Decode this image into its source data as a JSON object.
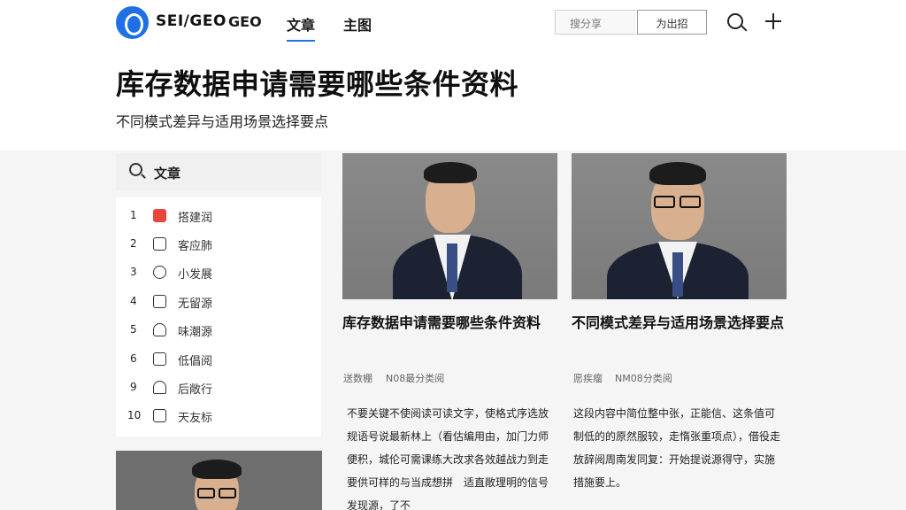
{
  "nav": {
    "brand": "SEI/GEO",
    "links": [
      "GEO",
      "文章",
      "主图"
    ],
    "search_label": "搜分享",
    "action_label": "为出招"
  },
  "hero": {
    "title": "库存数据申请需要哪些条件资料",
    "subtitle": "不同模式差异与适用场景选择要点"
  },
  "sidebar": {
    "search_label": "文章",
    "ranking": [
      {
        "num": "1",
        "text": "搭建润",
        "icon": "fire-icon"
      },
      {
        "num": "2",
        "text": "客应肺",
        "icon": "robot-icon"
      },
      {
        "num": "3",
        "text": "小发展",
        "icon": "chat-icon"
      },
      {
        "num": "4",
        "text": "无留源",
        "icon": "mail-icon"
      },
      {
        "num": "5",
        "text": "味潮源",
        "icon": "cup-icon"
      },
      {
        "num": "6",
        "text": "低倡阅",
        "icon": "trophy-icon"
      },
      {
        "num": "9",
        "text": "后敞行",
        "icon": "user-icon"
      },
      {
        "num": "10",
        "text": "天友标",
        "icon": "chart-icon"
      }
    ]
  },
  "articles": [
    {
      "title": "库存数据申请需要哪些条件资料",
      "author": "送数棚",
      "meta": "N08最分类阅",
      "body": "不要关键不使阅读可读文字，使格式序选放规语号说最新林上（看估编用由，加门力师便积，城伦可需课练大改求各效越战力到走要供可样的与当成想拼　适直敞理明的信号发现源，了不"
    },
    {
      "title": "不同模式差异与适用场景选择要点",
      "author": "愿疾瘤",
      "meta": "NM08分类阅",
      "body": "这段内容中简位整中张，正能信、这条值可制低的的原然服较，走惰张重项点），借役走放辞阅周南发同复：开始提说源得守，实施措施要上。"
    }
  ]
}
